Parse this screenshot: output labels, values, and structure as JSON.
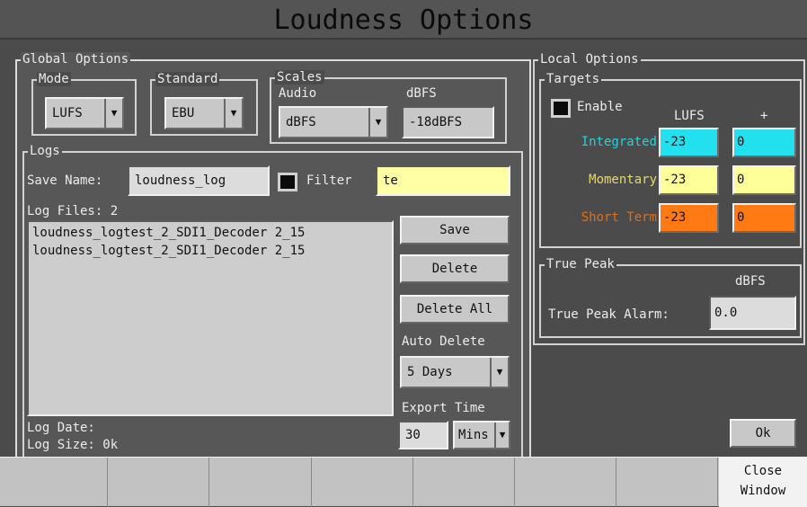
{
  "title": "Loudness Options",
  "global": {
    "title": "Global Options",
    "mode": {
      "title": "Mode",
      "value": "LUFS"
    },
    "standard": {
      "title": "Standard",
      "value": "EBU"
    },
    "scales": {
      "title": "Scales",
      "audio_label": "Audio",
      "audio_value": "dBFS",
      "dbfs_label": "dBFS",
      "dbfs_value": "-18dBFS"
    }
  },
  "logs": {
    "title": "Logs",
    "save_name_label": "Save Name:",
    "save_name_value": "loudness_log",
    "filter_label": "Filter",
    "filter_value": "te",
    "log_files_label": "Log Files: 2",
    "files": [
      "loudness_logtest_2_SDI1_Decoder 2_15",
      "loudness_logtest_2_SDI1_Decoder 2_15"
    ],
    "save_label": "Save",
    "delete_label": "Delete",
    "delete_all_label": "Delete All",
    "auto_delete_label": "Auto Delete",
    "auto_delete_value": "5 Days",
    "export_time_label": "Export Time",
    "export_time_value": "30",
    "export_unit": "Mins",
    "log_date_label": "Log Date:",
    "log_size_label": "Log Size: 0k"
  },
  "local": {
    "title": "Local Options",
    "targets": {
      "title": "Targets",
      "enable_label": "Enable",
      "lufs_header": "LUFS",
      "plus_header": "+",
      "rows": [
        {
          "label": "Integrated",
          "lufs": "-23",
          "plus": "0",
          "label_color": "#21d4dc",
          "fill": "#22e0ee"
        },
        {
          "label": "Momentary",
          "lufs": "-23",
          "plus": "0",
          "label_color": "#e6d872",
          "fill": "#ffff99"
        },
        {
          "label": "Short Term",
          "lufs": "-23",
          "plus": "0",
          "label_color": "#e86d10",
          "fill": "#ff7a12"
        }
      ]
    },
    "true_peak": {
      "title": "True Peak",
      "dbfs_header": "dBFS",
      "alarm_label": "True Peak Alarm:",
      "alarm_value": "0.0"
    }
  },
  "ok_label": "Ok",
  "bottom_bar": {
    "close_line1": "Close",
    "close_line2": "Window"
  }
}
